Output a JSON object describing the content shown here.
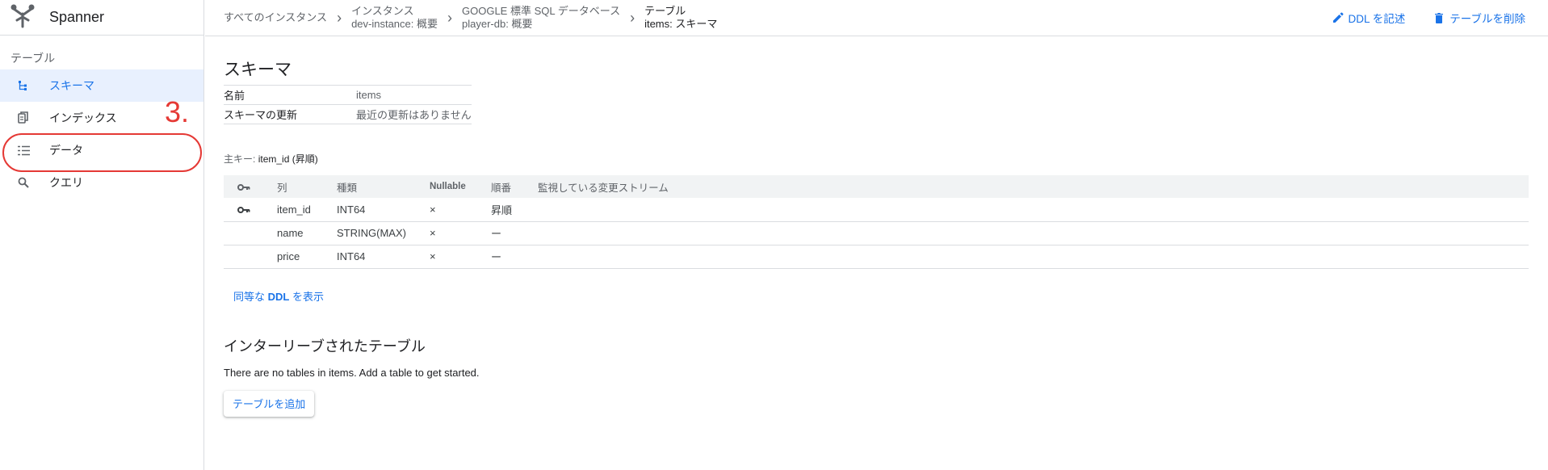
{
  "app": {
    "name": "Spanner"
  },
  "sidebar": {
    "heading": "テーブル",
    "items": [
      {
        "label": "スキーマ",
        "icon": "schema-icon",
        "active": true
      },
      {
        "label": "インデックス",
        "icon": "index-icon",
        "active": false
      },
      {
        "label": "データ",
        "icon": "data-icon",
        "active": false
      },
      {
        "label": "クエリ",
        "icon": "search-icon",
        "active": false
      }
    ]
  },
  "annotation": {
    "step": "3.",
    "color": "#e53935"
  },
  "breadcrumb": [
    {
      "line1": "すべてのインスタンス",
      "line2": ""
    },
    {
      "line1": "インスタンス",
      "line2": "dev-instance: 概要"
    },
    {
      "line1": "GOOGLE 標準 SQL データベース",
      "line2": "player-db: 概要"
    },
    {
      "line1": "テーブル",
      "line2": "items: スキーマ"
    }
  ],
  "actions": {
    "write_ddl": "DDL を記述",
    "delete_table": "テーブルを削除"
  },
  "schema": {
    "title": "スキーマ",
    "name_label": "名前",
    "name_value": "items",
    "update_label": "スキーマの更新",
    "update_value": "最近の更新はありません"
  },
  "primary_key": {
    "label": "主キー:",
    "value": "item_id (昇順)"
  },
  "columns_table": {
    "headers": {
      "column": "列",
      "type": "種類",
      "nullable": "Nullable",
      "order": "順番",
      "streams": "監視している変更ストリーム"
    },
    "rows": [
      {
        "is_key": true,
        "name": "item_id",
        "type": "INT64",
        "nullable": "×",
        "order": "昇順",
        "streams": ""
      },
      {
        "is_key": false,
        "name": "name",
        "type": "STRING(MAX)",
        "nullable": "×",
        "order": "ー",
        "streams": ""
      },
      {
        "is_key": false,
        "name": "price",
        "type": "INT64",
        "nullable": "×",
        "order": "ー",
        "streams": ""
      }
    ]
  },
  "ddl_link": {
    "prefix": "同等な ",
    "bold": "DDL",
    "suffix": " を表示"
  },
  "interleaved": {
    "title": "インターリーブされたテーブル",
    "empty_text": "There are no tables in items. Add a table to get started.",
    "add_button": "テーブルを追加"
  },
  "colors": {
    "accent": "#1a73e8",
    "active_bg": "#e8f0fe",
    "header_bg": "#f1f3f4",
    "divider": "#dadce0"
  }
}
